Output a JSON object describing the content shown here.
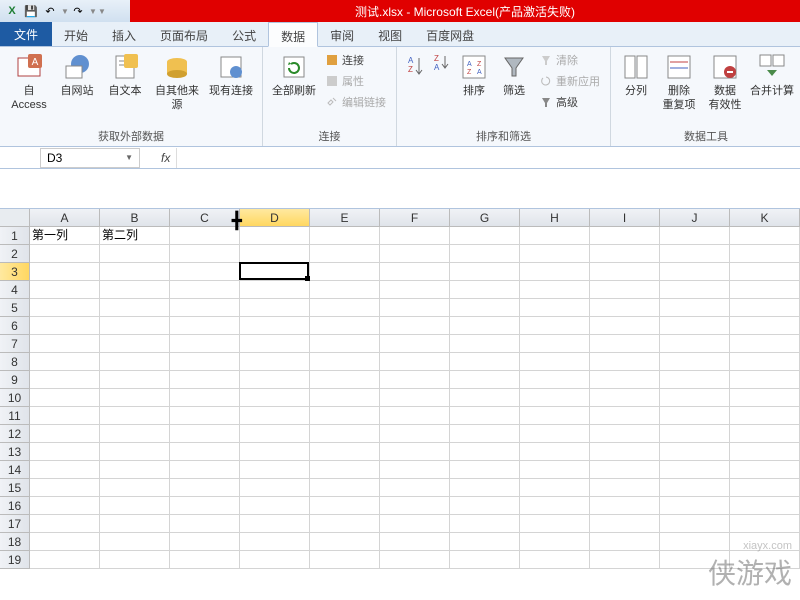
{
  "title": "测试.xlsx - Microsoft Excel(产品激活失败)",
  "tabs": {
    "file": "文件",
    "t0": "开始",
    "t1": "插入",
    "t2": "页面布局",
    "t3": "公式",
    "t4": "数据",
    "t5": "审阅",
    "t6": "视图",
    "t7": "百度网盘"
  },
  "ribbon": {
    "g1": {
      "label": "获取外部数据",
      "b0": "自 Access",
      "b1": "自网站",
      "b2": "自文本",
      "b3": "自其他来源",
      "b4": "现有连接"
    },
    "g2": {
      "label": "连接",
      "b0": "全部刷新",
      "s0": "连接",
      "s1": "属性",
      "s2": "编辑链接"
    },
    "g3": {
      "label": "排序和筛选",
      "b0": "排序",
      "b1": "筛选",
      "s0": "清除",
      "s1": "重新应用",
      "s2": "高级"
    },
    "g4": {
      "label": "数据工具",
      "b0": "分列",
      "b1": "删除\n重复项",
      "b2": "数据\n有效性",
      "b3": "合并计算"
    }
  },
  "formula": {
    "name": "D3",
    "fx": "fx"
  },
  "cols": [
    "A",
    "B",
    "C",
    "D",
    "E",
    "F",
    "G",
    "H",
    "I",
    "J",
    "K"
  ],
  "rows": [
    "1",
    "2",
    "3",
    "4",
    "5",
    "6",
    "7",
    "8",
    "9",
    "10",
    "11",
    "12",
    "13",
    "14",
    "15",
    "16",
    "17",
    "18",
    "19"
  ],
  "cells": {
    "A1": "第一列",
    "B1": "第二列"
  },
  "sel": {
    "col": "D",
    "row": "3"
  },
  "watermark": {
    "url": "xiayx.com",
    "txt": "侠游戏"
  }
}
